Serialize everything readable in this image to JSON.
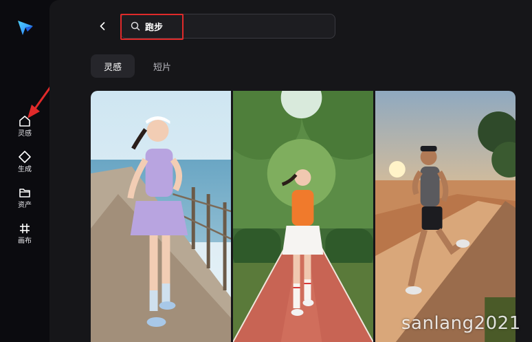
{
  "sidebar": {
    "items": [
      {
        "label": "灵感",
        "icon": "home-icon"
      },
      {
        "label": "生成",
        "icon": "sparkle-icon"
      },
      {
        "label": "资产",
        "icon": "folder-icon"
      },
      {
        "label": "画布",
        "icon": "canvas-icon"
      }
    ]
  },
  "search": {
    "value": "跑步"
  },
  "tabs": [
    {
      "label": "灵感",
      "active": true
    },
    {
      "label": "短片",
      "active": false
    }
  ],
  "watermark": "sanlang2021",
  "colors": {
    "accent_red": "#e02a2a",
    "background": "#0b0b0f",
    "panel": "#161619"
  }
}
